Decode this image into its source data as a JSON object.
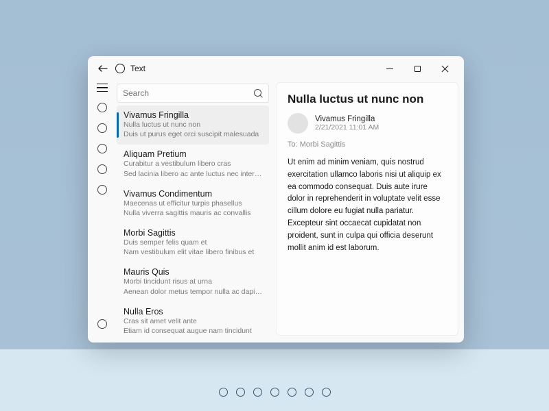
{
  "app": {
    "title": "Text"
  },
  "search": {
    "placeholder": "Search"
  },
  "list": {
    "items": [
      {
        "title": "Vivamus Fringilla",
        "line1": "Nulla luctus ut nunc non",
        "line2": "Duis ut purus eget orci suscipit malesuada",
        "selected": true
      },
      {
        "title": "Aliquam Pretium",
        "line1": "Curabitur a vestibulum libero cras",
        "line2": "Sed lacinia libero ac ante luctus nec interdum",
        "selected": false
      },
      {
        "title": "Vivamus Condimentum",
        "line1": "Maecenas ut efficitur turpis phasellus",
        "line2": "Nulla viverra sagittis mauris ac convallis",
        "selected": false
      },
      {
        "title": "Morbi Sagittis",
        "line1": "Duis semper felis quam et",
        "line2": "Nam vestibulum elit vitae libero finibus et",
        "selected": false
      },
      {
        "title": "Mauris Quis",
        "line1": "Morbi tincidunt risus at urna",
        "line2": "Aenean dolor metus tempor nulla ac dapibus",
        "selected": false
      },
      {
        "title": "Nulla Eros",
        "line1": "Cras sit amet velit ante",
        "line2": "Etiam id consequat augue nam tincidunt",
        "selected": false
      }
    ]
  },
  "detail": {
    "title": "Nulla luctus ut nunc non",
    "from": "Vivamus Fringilla",
    "date": "2/21/2021 11:01 AM",
    "to_label": "To:",
    "to_value": "Morbi Sagittis",
    "body": "Ut enim ad minim veniam, quis nostrud exercitation ullamco laboris nisi ut aliquip ex ea commodo consequat. Duis aute irure dolor in reprehenderit in voluptate velit esse cillum dolore eu fugiat nulla pariatur. Excepteur sint occaecat cupidatat non proident, sunt in culpa qui officia deserunt mollit anim id est laborum."
  },
  "nav": {
    "item_count": 5
  },
  "pager": {
    "dot_count": 7
  }
}
